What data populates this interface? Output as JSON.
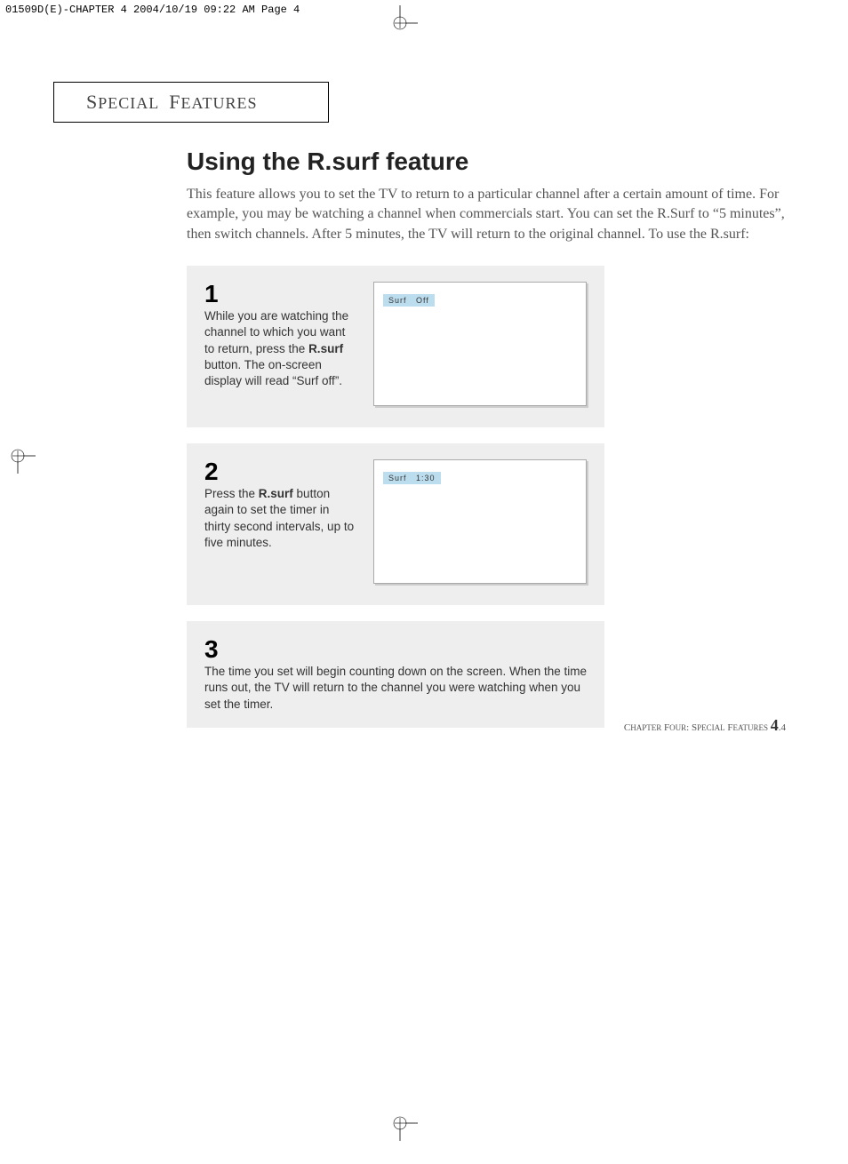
{
  "preheader": "01509D(E)-CHAPTER 4  2004/10/19  09:22 AM  Page 4",
  "section_label": {
    "s": "S",
    "pecial": "PECIAL",
    "f": "F",
    "eatures": "EATURES"
  },
  "title": "Using the R.surf feature",
  "intro": "This feature allows you to set the TV to return to a particular channel after a certain amount of time. For example, you may be watching a channel when commercials start. You can set the R.Surf to “5 minutes”, then switch channels. After 5 minutes, the TV will return to the original channel. To use the R.surf:",
  "steps": [
    {
      "num": "1",
      "text_pre": "While you are watching the channel to which you want to return, press the ",
      "text_bold": "R.surf",
      "text_post": " button. The on-screen display will read “Surf off”.",
      "surf_label": "Surf",
      "surf_value": "Off"
    },
    {
      "num": "2",
      "text_pre": "Press the ",
      "text_bold": "R.surf",
      "text_post": " button again to set the timer in thirty second intervals, up to five minutes.",
      "surf_label": "Surf",
      "surf_value": "1:30"
    },
    {
      "num": "3",
      "text": "The time you set will begin counting down on the screen. When the time runs out, the TV will return to the channel you were watching when you set the timer."
    }
  ],
  "footer": {
    "chapter": "C",
    "hapter": "HAPTER",
    "four": "F",
    "our": "OUR",
    "colon": ": ",
    "s": "S",
    "pecial": "PECIAL",
    "f": "F",
    "eatures": "EATURES",
    "page": "4",
    "sub": ".4"
  }
}
